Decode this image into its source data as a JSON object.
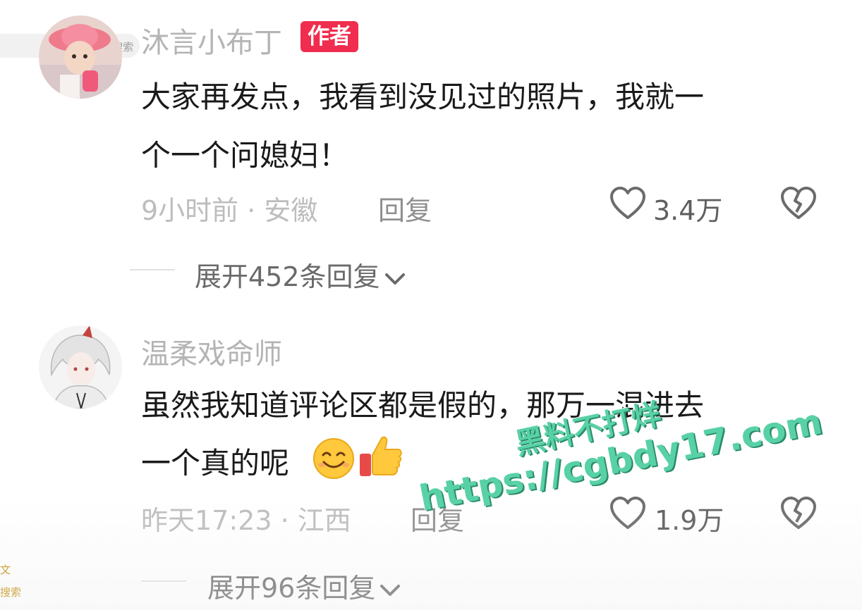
{
  "overlay": {
    "search_label": "搜索",
    "corner_char": "文",
    "corner_search": "搜索"
  },
  "comments": [
    {
      "username": "沐言小布丁",
      "badge": "作者",
      "line1": "大家再发点，我看到没见过的照片，我就一",
      "line2": "个一个问媳妇！",
      "meta": "9小时前 · 安徽",
      "reply_label": "回复",
      "likes": "3.4万",
      "expand_label": "展开452条回复",
      "avatar_icon": "baby-pink-hat-avatar"
    },
    {
      "username": "温柔戏命师",
      "line1": "虽然我知道评论区都是假的，那万一混进去",
      "line2": "一个真的呢",
      "emoji": [
        "smiling-face-emoji",
        "thumbs-up-emoji"
      ],
      "meta": "昨天17:23 · 江西",
      "reply_label": "回复",
      "likes": "1.9万",
      "expand_label": "展开96条回复",
      "avatar_icon": "anime-white-hair-avatar"
    }
  ],
  "watermark": {
    "line1": "黑料不打烊",
    "line2": "https://cgbdy17.com"
  },
  "colors": {
    "badge": "#f02d4e",
    "watermark": "#58d1a6",
    "username": "#b4b4b4",
    "text": "#1a1a1a"
  }
}
